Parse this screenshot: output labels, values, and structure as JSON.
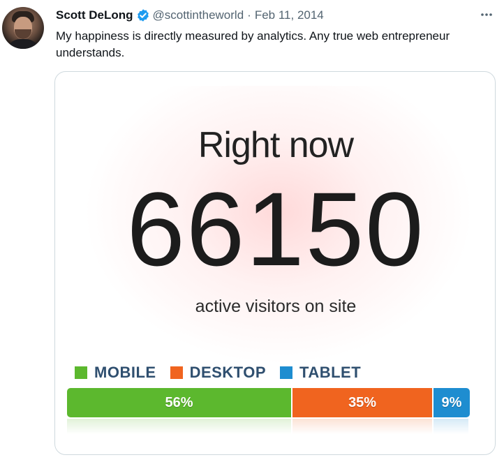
{
  "tweet": {
    "author": {
      "display_name": "Scott DeLong",
      "handle": "@scottintheworld",
      "verified": true
    },
    "separator": "·",
    "date": "Feb 11, 2014",
    "more_icon": "more-horizontal-icon",
    "text": "My happiness is directly measured by analytics. Any true web entrepreneur understands."
  },
  "media": {
    "heading": "Right now",
    "active_visitors": "66150",
    "caption": "active visitors on site",
    "legend": [
      {
        "label": "MOBILE",
        "color": "#5cb82e"
      },
      {
        "label": "DESKTOP",
        "color": "#f0641f"
      },
      {
        "label": "TABLET",
        "color": "#1e8dd0"
      }
    ],
    "breakdown": [
      {
        "label": "56%",
        "share": 0.56,
        "color": "#5cb82e"
      },
      {
        "label": "35%",
        "share": 0.35,
        "color": "#f0641f"
      },
      {
        "label": "9%",
        "share": 0.09,
        "color": "#1e8dd0"
      }
    ]
  },
  "colors": {
    "verified_badge": "#1d9bf0",
    "secondary_text": "#536471"
  }
}
